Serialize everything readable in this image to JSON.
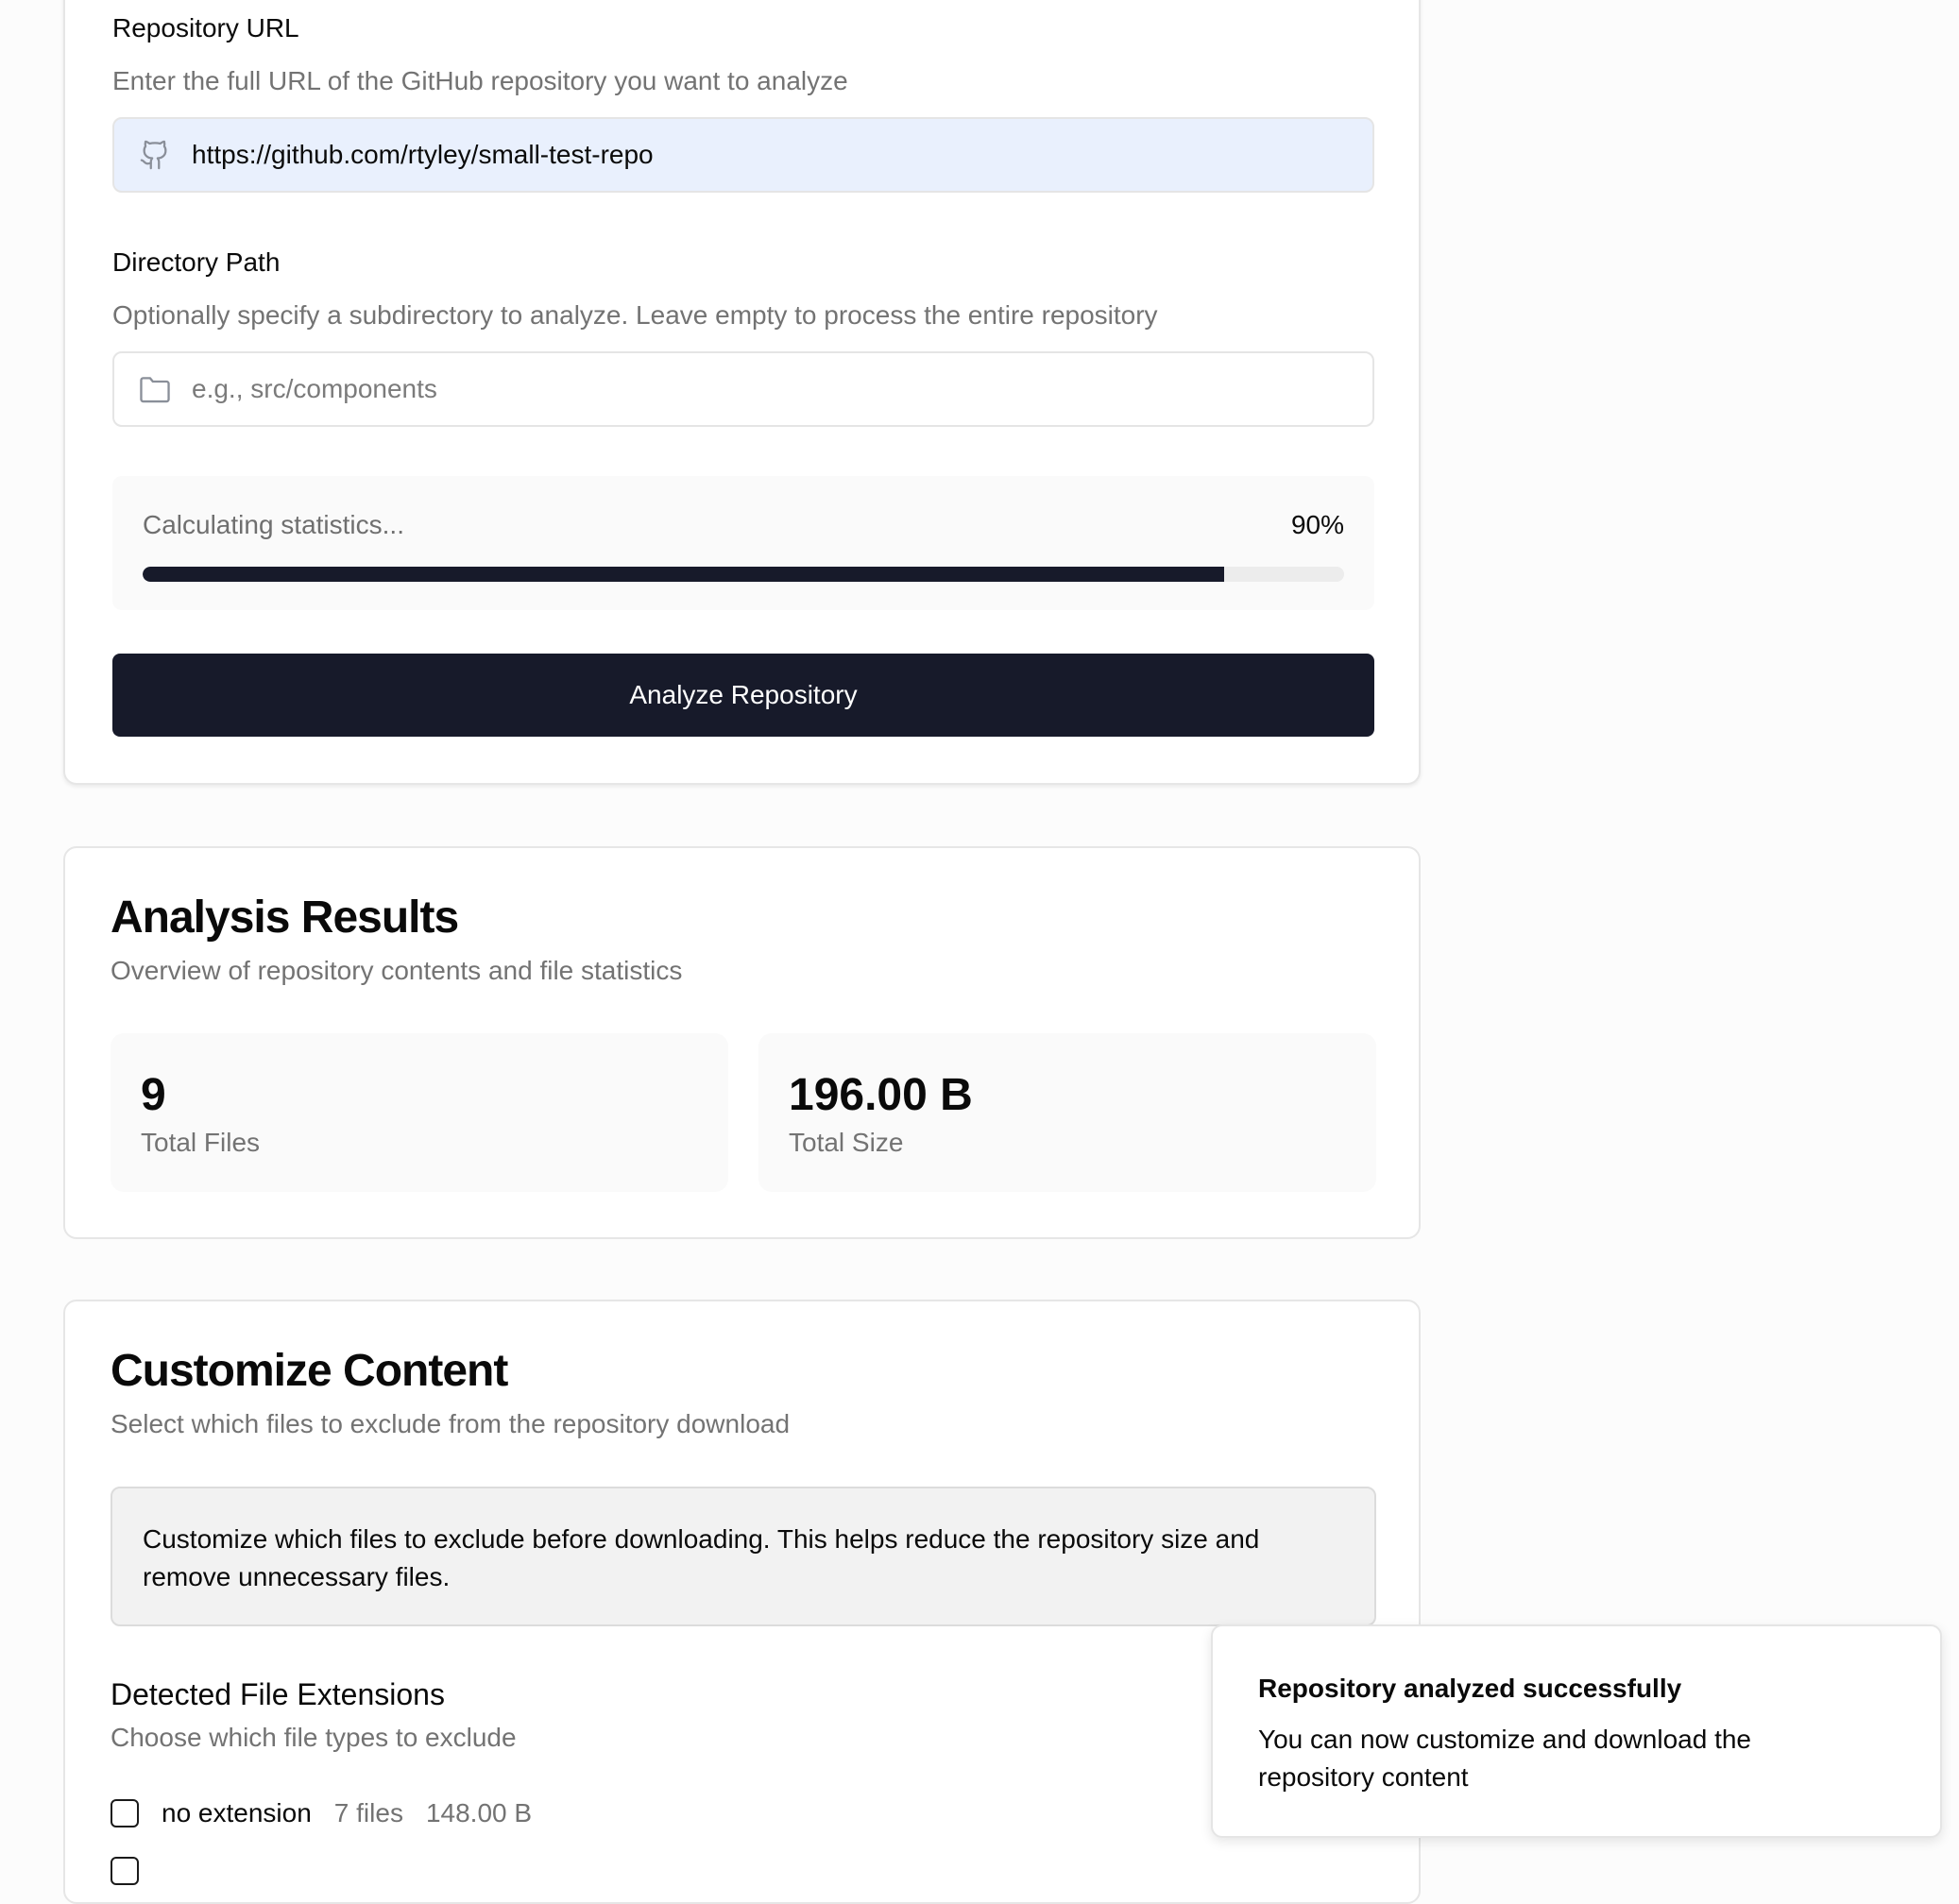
{
  "repo_form": {
    "url_label": "Repository URL",
    "url_description": "Enter the full URL of the GitHub repository you want to analyze",
    "url_value": "https://github.com/rtyley/small-test-repo",
    "url_icon": "github-icon",
    "path_label": "Directory Path",
    "path_description": "Optionally specify a subdirectory to analyze. Leave empty to process the entire repository",
    "path_placeholder": "e.g., src/components",
    "path_icon": "folder-icon",
    "progress": {
      "status_text": "Calculating statistics...",
      "percent_text": "90%",
      "percent": 90
    },
    "analyze_button": "Analyze Repository"
  },
  "analysis": {
    "title": "Analysis Results",
    "subtitle": "Overview of repository contents and file statistics",
    "stats": [
      {
        "value": "9",
        "label": "Total Files"
      },
      {
        "value": "196.00 B",
        "label": "Total Size"
      }
    ]
  },
  "customize": {
    "title": "Customize Content",
    "subtitle": "Select which files to exclude from the repository download",
    "info": "Customize which files to exclude before downloading. This helps reduce the repository size and remove unnecessary files.",
    "extensions_title": "Detected File Extensions",
    "extensions_subtitle": "Choose which file types to exclude",
    "extensions": [
      {
        "name": "no extension",
        "count": "7 files",
        "size": "148.00 B"
      }
    ]
  },
  "toast": {
    "title": "Repository analyzed successfully",
    "message": "You can now customize and download the repository content"
  },
  "colors": {
    "primary": "#171a2a",
    "input_filled_bg": "#e9f0fd",
    "muted_text": "#737373"
  }
}
